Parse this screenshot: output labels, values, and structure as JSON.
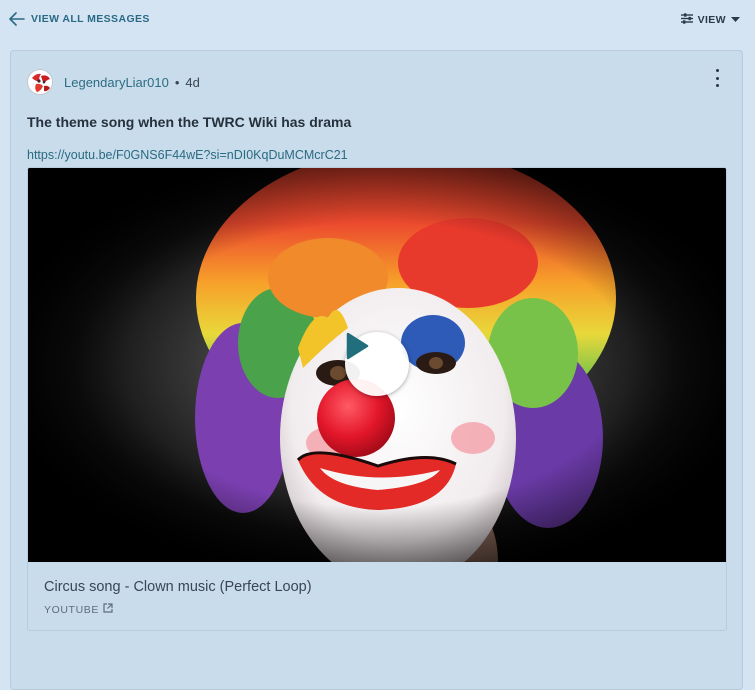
{
  "nav": {
    "back_label": "VIEW ALL MESSAGES",
    "view_label": "VIEW"
  },
  "post": {
    "author": "LegendaryLiar010",
    "separator": "•",
    "time": "4d",
    "title": "The theme song when the TWRC Wiki has drama",
    "link": "https://youtu.be/F0GNS6F44wE?si=nDI0KqDuMCMcrC21"
  },
  "embed": {
    "title": "Circus song - Clown music (Perfect Loop)",
    "source": "YOUTUBE"
  },
  "colors": {
    "page_bg": "#d4e4f3",
    "card_bg": "#c9dcec",
    "link": "#2a6b80",
    "accent": "#2a6a85"
  },
  "icons": {
    "back": "arrow-left-icon",
    "view": "sliders-icon",
    "dropdown": "caret-down-icon",
    "menu": "kebab-menu-icon",
    "play": "play-icon",
    "external": "external-link-icon"
  }
}
